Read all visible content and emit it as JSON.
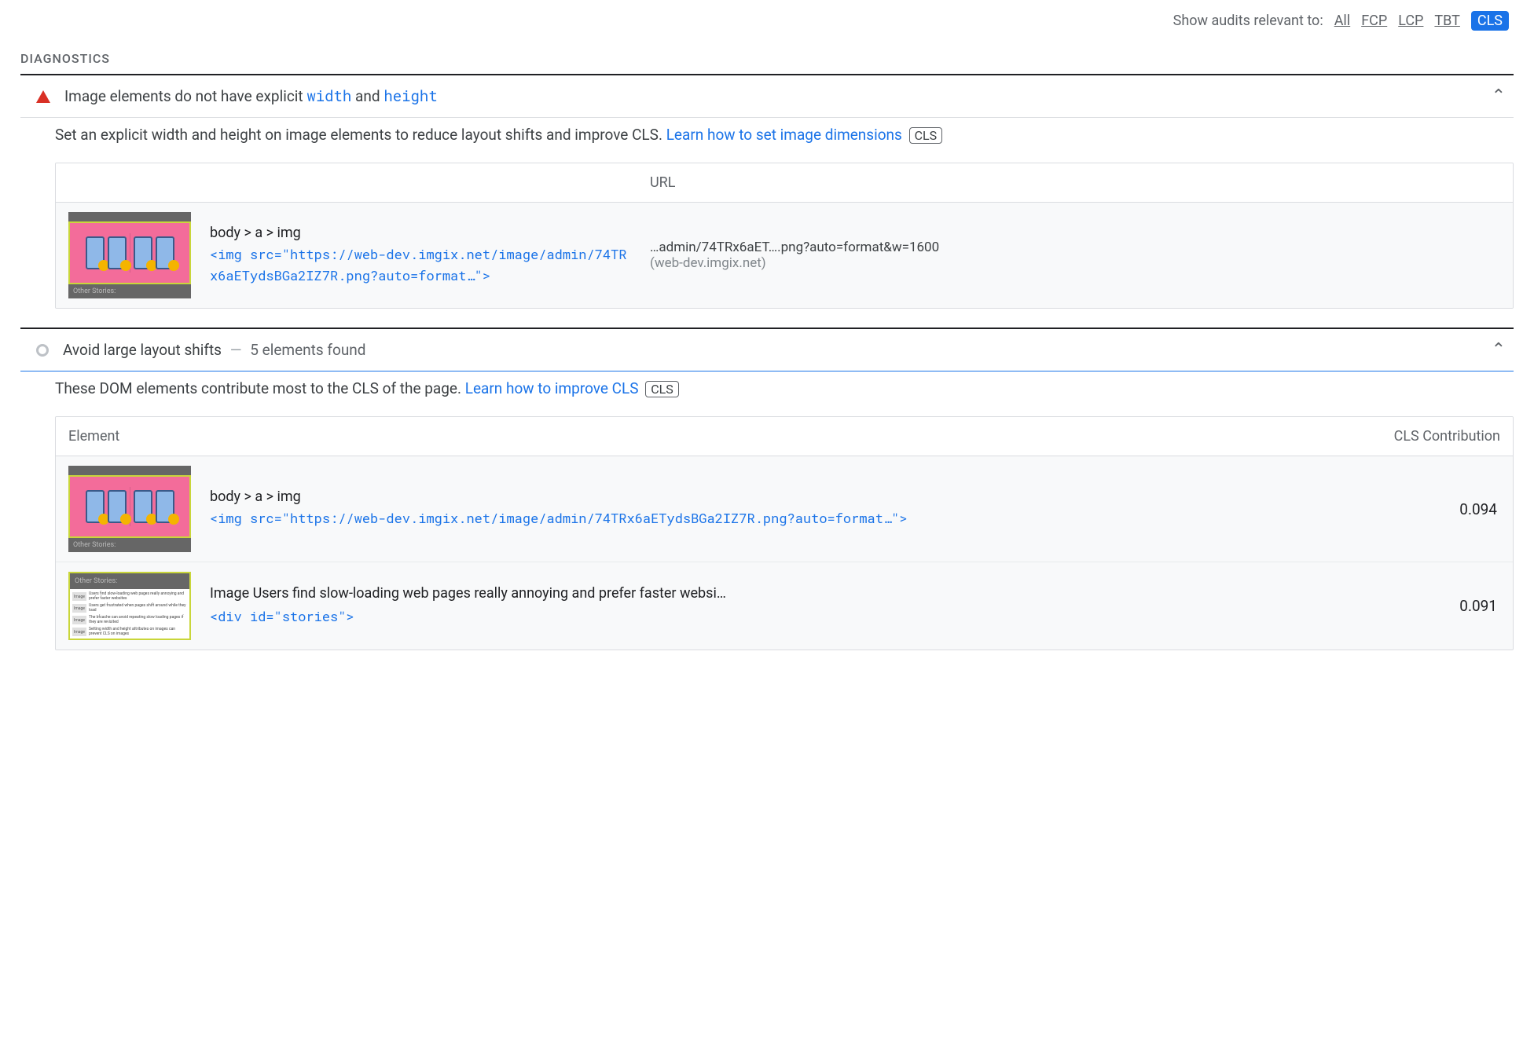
{
  "filter": {
    "label": "Show audits relevant to:",
    "options": [
      "All",
      "FCP",
      "LCP",
      "TBT",
      "CLS"
    ],
    "active": "CLS"
  },
  "section_title": "DIAGNOSTICS",
  "audit1": {
    "title_pre": "Image elements do not have explicit ",
    "code1": "width",
    "title_mid": " and ",
    "code2": "height",
    "desc_pre": "Set an explicit width and height on image elements to reduce layout shifts and improve CLS. ",
    "desc_link": "Learn how to set image dimensions",
    "desc_tag": "CLS",
    "table": {
      "col2": "URL",
      "row1": {
        "selector": "body > a > img",
        "snippet1": "<img src=\"https://web-dev.imgix.net/image/admin/74TRx6aETydsBGa2IZ7R.png?auto=format…\">",
        "url_main": "…admin/74TRx6aET….png?auto=format&w=1600",
        "url_host": "(web-dev.imgix.net)",
        "thumb_caption": "Other Stories:"
      }
    }
  },
  "audit2": {
    "title": "Avoid large layout shifts",
    "dash": "—",
    "subtitle": "5 elements found",
    "desc_pre": "These DOM elements contribute most to the CLS of the page. ",
    "desc_link": "Learn how to improve CLS",
    "desc_tag": "CLS",
    "table": {
      "col1": "Element",
      "col2": "CLS Contribution",
      "row1": {
        "selector": "body > a > img",
        "snippet": "<img src=\"https://web-dev.imgix.net/image/admin/74TRx6aETydsBGa2IZ7R.png?auto=format…\">",
        "value": "0.094",
        "thumb_caption": "Other Stories:"
      },
      "row2": {
        "plain": "Image Users find slow-loading web pages really annoying and prefer faster websi…",
        "snippet": "<div id=\"stories\">",
        "value": "0.091",
        "thumb_caption": "Other Stories:",
        "li1": "Users find slow-loading web pages really annoying and prefer faster websites",
        "li2": "Users get frustrated when pages shift around while they load",
        "li3": "The bfcache can avoid repeating slow loading pages if they are revisited",
        "li4": "Setting width and height attributes on images can prevent CLS on images",
        "im": "Image"
      }
    }
  }
}
